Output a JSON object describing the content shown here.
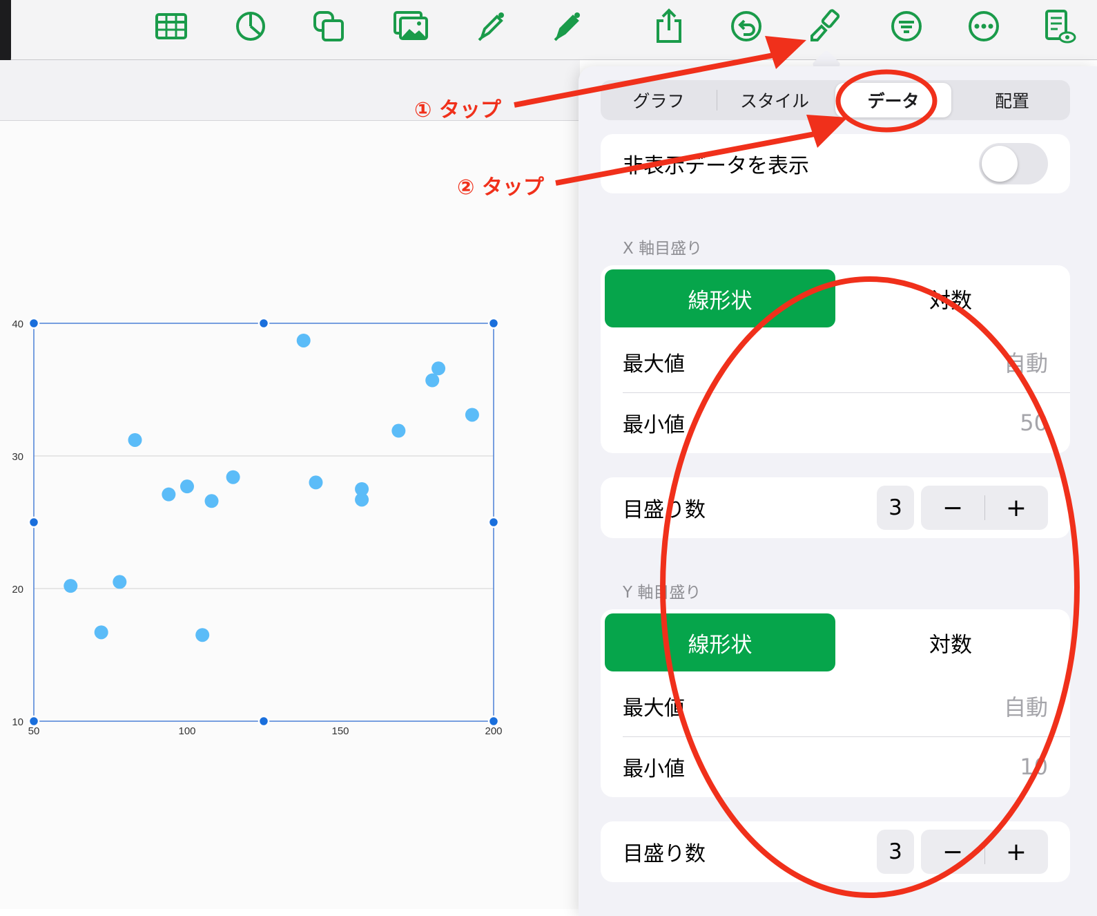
{
  "toolbar": {
    "icons": [
      "table-icon",
      "chart-icon",
      "shape-icon",
      "media-icon",
      "pen-icon",
      "pen-filled-icon",
      "share-icon",
      "undo-icon",
      "format-brush-icon",
      "organize-icon",
      "more-icon",
      "reader-view-icon"
    ],
    "accent": "#1a9b4a"
  },
  "popover": {
    "tabs": [
      {
        "label": "グラフ",
        "active": false
      },
      {
        "label": "スタイル",
        "active": false
      },
      {
        "label": "データ",
        "active": true
      },
      {
        "label": "配置",
        "active": false
      }
    ],
    "show_hidden_label": "非表示データを表示",
    "show_hidden_on": false,
    "x_axis": {
      "section_label": "X 軸目盛り",
      "linear_label": "線形状",
      "log_label": "対数",
      "max_label": "最大値",
      "max_value": "自動",
      "min_label": "最小値",
      "min_value": "50",
      "ticks_label": "目盛り数",
      "ticks_value": "3",
      "minus": "−",
      "plus": "+"
    },
    "y_axis": {
      "section_label": "Y 軸目盛り",
      "linear_label": "線形状",
      "log_label": "対数",
      "max_label": "最大値",
      "max_value": "自動",
      "min_label": "最小値",
      "min_value": "10",
      "ticks_label": "目盛り数",
      "ticks_value": "3",
      "minus": "−",
      "plus": "+"
    },
    "accent": "#06a54b"
  },
  "annotations": {
    "step1": "① タップ",
    "step2": "② タップ",
    "color": "#f0301b"
  },
  "chart_data": {
    "type": "scatter",
    "xlim": [
      50,
      200
    ],
    "ylim": [
      10,
      40
    ],
    "x_ticks": [
      "50",
      "100",
      "150",
      "200"
    ],
    "y_ticks": [
      "10",
      "20",
      "30",
      "40"
    ],
    "grid": true,
    "point_color": "#5bbcf8",
    "points": [
      [
        62,
        20.2
      ],
      [
        72,
        16.7
      ],
      [
        78,
        20.5
      ],
      [
        83,
        31.2
      ],
      [
        94,
        27.1
      ],
      [
        100,
        27.7
      ],
      [
        105,
        16.5
      ],
      [
        108,
        26.6
      ],
      [
        115,
        28.4
      ],
      [
        138,
        38.7
      ],
      [
        142,
        28.0
      ],
      [
        157,
        27.5
      ],
      [
        157,
        26.7
      ],
      [
        169,
        31.9
      ],
      [
        180,
        35.7
      ],
      [
        182,
        36.6
      ],
      [
        193,
        33.1
      ]
    ]
  }
}
